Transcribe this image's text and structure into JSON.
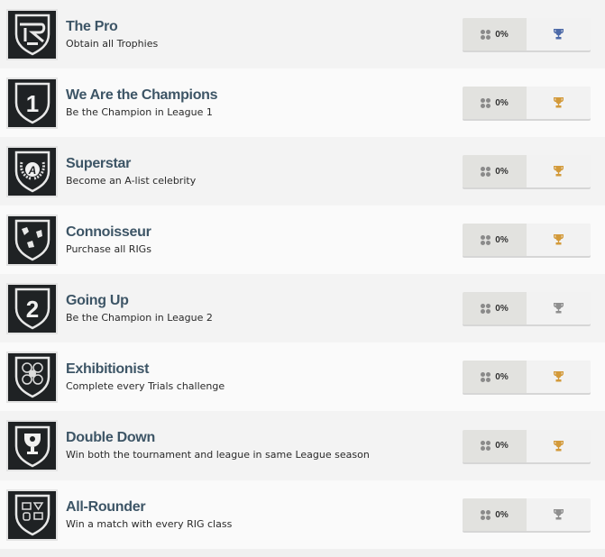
{
  "trophy_colors": {
    "platinum": "#4d6aa8",
    "gold": "#d39a3a",
    "silver": "#8f8f8f"
  },
  "trophies": [
    {
      "title": "The Pro",
      "description": "Obtain all Trophies",
      "progress": "0%",
      "type": "platinum",
      "icon": "r-logo-shield-icon"
    },
    {
      "title": "We Are the Champions",
      "description": "Be the Champion in League 1",
      "progress": "0%",
      "type": "gold",
      "icon": "number-1-shield-icon"
    },
    {
      "title": "Superstar",
      "description": "Become an A-list celebrity",
      "progress": "0%",
      "type": "gold",
      "icon": "laurel-a-shield-icon"
    },
    {
      "title": "Connoisseur",
      "description": "Purchase all RIGs",
      "progress": "0%",
      "type": "gold",
      "icon": "rigs-shield-icon"
    },
    {
      "title": "Going Up",
      "description": "Be the Champion in League 2",
      "progress": "0%",
      "type": "silver",
      "icon": "number-2-shield-icon"
    },
    {
      "title": "Exhibitionist",
      "description": "Complete every Trials challenge",
      "progress": "0%",
      "type": "gold",
      "icon": "trials-shield-icon"
    },
    {
      "title": "Double Down",
      "description": "Win both the tournament and league in same League season",
      "progress": "0%",
      "type": "gold",
      "icon": "cup-shield-icon"
    },
    {
      "title": "All-Rounder",
      "description": "Win a match with every RIG class",
      "progress": "0%",
      "type": "silver",
      "icon": "rig-classes-shield-icon"
    }
  ]
}
